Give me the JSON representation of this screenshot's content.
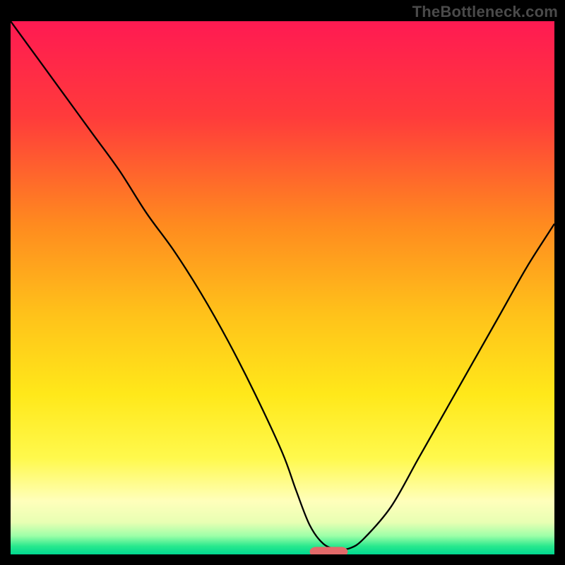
{
  "watermark": "TheBottleneck.com",
  "chart_data": {
    "type": "line",
    "title": "",
    "xlabel": "",
    "ylabel": "",
    "xlim": [
      0,
      100
    ],
    "ylim": [
      0,
      100
    ],
    "background_gradient": {
      "stops": [
        {
          "pos": 0.0,
          "color": "#ff1a52"
        },
        {
          "pos": 0.18,
          "color": "#ff3b3b"
        },
        {
          "pos": 0.38,
          "color": "#ff8a1f"
        },
        {
          "pos": 0.55,
          "color": "#ffc21a"
        },
        {
          "pos": 0.7,
          "color": "#ffe81a"
        },
        {
          "pos": 0.82,
          "color": "#fff94d"
        },
        {
          "pos": 0.9,
          "color": "#ffffbb"
        },
        {
          "pos": 0.94,
          "color": "#e8ffb3"
        },
        {
          "pos": 0.965,
          "color": "#9effa8"
        },
        {
          "pos": 0.985,
          "color": "#27e88d"
        },
        {
          "pos": 1.0,
          "color": "#00d890"
        }
      ]
    },
    "series": [
      {
        "name": "bottleneck-curve",
        "color": "#000000",
        "width": 2.3,
        "x": [
          0,
          5,
          10,
          15,
          20,
          25,
          30,
          35,
          40,
          45,
          50,
          52.5,
          55,
          57.5,
          60,
          62.5,
          65,
          70,
          75,
          80,
          85,
          90,
          95,
          100
        ],
        "y": [
          100,
          93,
          86,
          79,
          72,
          64,
          57,
          49,
          40,
          30,
          19,
          12,
          5.5,
          2,
          1,
          1.2,
          3,
          9,
          18,
          27,
          36,
          45,
          54,
          62
        ]
      }
    ],
    "marker": {
      "name": "optimal-marker",
      "color": "#e36a6a",
      "x": 58.5,
      "y": 0.5,
      "width": 7,
      "height": 1.8,
      "rx": 1.2
    }
  }
}
